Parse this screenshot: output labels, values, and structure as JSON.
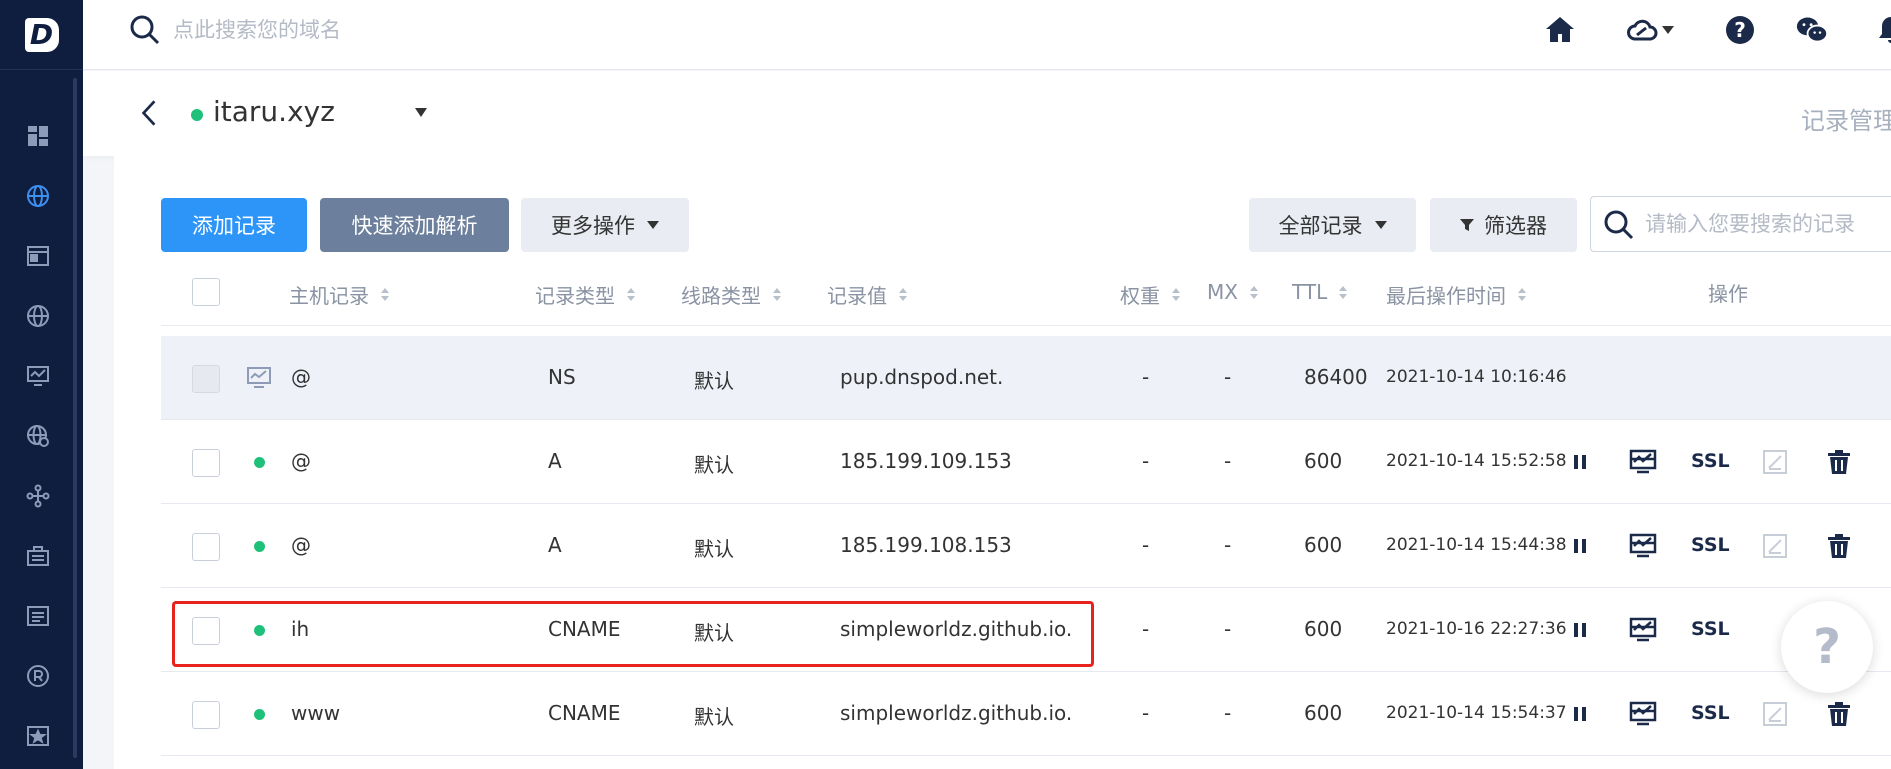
{
  "topbar": {
    "search_placeholder": "点此搜索您的域名",
    "icons": [
      "home-icon",
      "cloud-icon",
      "help-icon",
      "wechat-icon",
      "bell-icon"
    ]
  },
  "sidebar": {
    "logo": "D",
    "items": [
      "dashboard-icon",
      "dns-globe-icon",
      "window-icon",
      "globe-icon",
      "monitor-icon",
      "globe-settings-icon",
      "network-icon",
      "briefcase-icon",
      "list-icon",
      "registered-icon",
      "star-box-icon"
    ]
  },
  "domain": {
    "name": "itaru.xyz",
    "status_color": "#1fc07a",
    "record_manage": "记录管理"
  },
  "toolbar": {
    "add_record": "添加记录",
    "quick_add": "快速添加解析",
    "more_actions": "更多操作",
    "all_records": "全部记录",
    "filter": "筛选器",
    "search_placeholder": "请输入您要搜索的记录"
  },
  "table": {
    "headers": {
      "host": "主机记录",
      "type": "记录类型",
      "line": "线路类型",
      "value": "记录值",
      "weight": "权重",
      "mx": "MX",
      "ttl": "TTL",
      "time": "最后操作时间",
      "ops": "操作"
    },
    "rows": [
      {
        "host": "@",
        "type": "NS",
        "line": "默认",
        "value": "pup.dnspod.net.",
        "weight": "-",
        "mx": "-",
        "ttl": "86400",
        "time": "2021-10-14 10:16:46"
      },
      {
        "host": "@",
        "type": "A",
        "line": "默认",
        "value": "185.199.109.153",
        "weight": "-",
        "mx": "-",
        "ttl": "600",
        "time": "2021-10-14 15:52:58",
        "ssl": "SSL"
      },
      {
        "host": "@",
        "type": "A",
        "line": "默认",
        "value": "185.199.108.153",
        "weight": "-",
        "mx": "-",
        "ttl": "600",
        "time": "2021-10-14 15:44:38",
        "ssl": "SSL"
      },
      {
        "host": "ih",
        "type": "CNAME",
        "line": "默认",
        "value": "simpleworldz.github.io.",
        "weight": "-",
        "mx": "-",
        "ttl": "600",
        "time": "2021-10-16 22:27:36",
        "ssl": "SSL"
      },
      {
        "host": "www",
        "type": "CNAME",
        "line": "默认",
        "value": "simpleworldz.github.io.",
        "weight": "-",
        "mx": "-",
        "ttl": "600",
        "time": "2021-10-14 15:54:37",
        "ssl": "SSL"
      }
    ]
  },
  "help_float": "?",
  "colors": {
    "sidebar": "#0f1d3f",
    "primary": "#2e95f8",
    "secondary": "#6c7f9c",
    "highlight": "#e8231e",
    "status_green": "#1fc07a"
  }
}
